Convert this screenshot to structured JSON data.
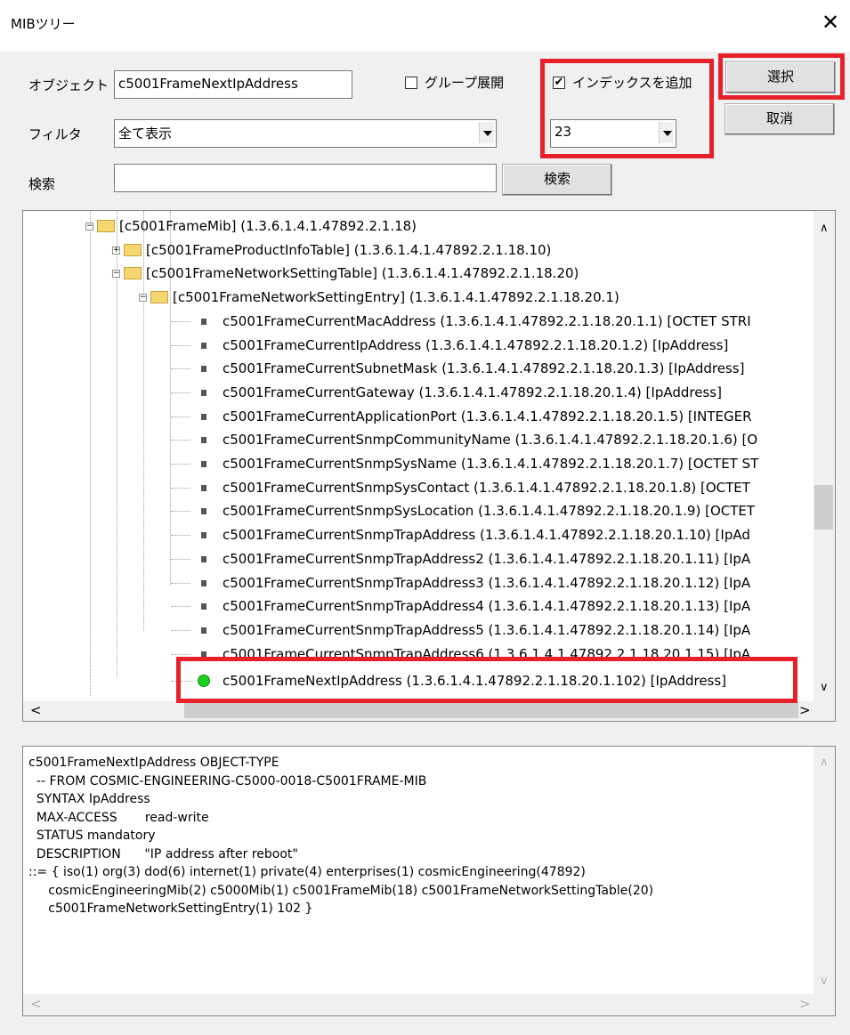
{
  "window": {
    "title": "MIBツリー",
    "close_label": "✕"
  },
  "form": {
    "object_label": "オブジェクト",
    "object_value": "c5001FrameNextIpAddress",
    "group_expand_label": "グループ展開",
    "group_expand_checked": false,
    "add_index_label": "インデックスを追加",
    "add_index_checked": true,
    "index_value": "23",
    "filter_label": "フィルタ",
    "filter_value": "全て表示",
    "search_label": "検索",
    "search_value": "",
    "search_button": "検索",
    "select_button": "選択",
    "cancel_button": "取消"
  },
  "tree": {
    "nodes": [
      {
        "type": "folder",
        "expander": "−",
        "text": "[c5001FrameMib] (1.3.6.1.4.1.47892.2.1.18)"
      },
      {
        "type": "folder",
        "expander": "+",
        "text": "[c5001FrameProductInfoTable] (1.3.6.1.4.1.47892.2.1.18.10)"
      },
      {
        "type": "folder",
        "expander": "−",
        "text": "[c5001FrameNetworkSettingTable] (1.3.6.1.4.1.47892.2.1.18.20)"
      },
      {
        "type": "folder",
        "expander": "−",
        "text": "[c5001FrameNetworkSettingEntry] (1.3.6.1.4.1.47892.2.1.18.20.1)"
      },
      {
        "type": "leaf",
        "text": "c5001FrameCurrentMacAddress (1.3.6.1.4.1.47892.2.1.18.20.1.1) [OCTET STRI"
      },
      {
        "type": "leaf",
        "text": "c5001FrameCurrentIpAddress (1.3.6.1.4.1.47892.2.1.18.20.1.2) [IpAddress]"
      },
      {
        "type": "leaf",
        "text": "c5001FrameCurrentSubnetMask (1.3.6.1.4.1.47892.2.1.18.20.1.3) [IpAddress]"
      },
      {
        "type": "leaf",
        "text": "c5001FrameCurrentGateway (1.3.6.1.4.1.47892.2.1.18.20.1.4) [IpAddress]"
      },
      {
        "type": "leaf",
        "text": "c5001FrameCurrentApplicationPort (1.3.6.1.4.1.47892.2.1.18.20.1.5) [INTEGER"
      },
      {
        "type": "leaf",
        "text": "c5001FrameCurrentSnmpCommunityName (1.3.6.1.4.1.47892.2.1.18.20.1.6) [O"
      },
      {
        "type": "leaf",
        "text": "c5001FrameCurrentSnmpSysName (1.3.6.1.4.1.47892.2.1.18.20.1.7) [OCTET ST"
      },
      {
        "type": "leaf",
        "text": "c5001FrameCurrentSnmpSysContact (1.3.6.1.4.1.47892.2.1.18.20.1.8) [OCTET"
      },
      {
        "type": "leaf",
        "text": "c5001FrameCurrentSnmpSysLocation (1.3.6.1.4.1.47892.2.1.18.20.1.9) [OCTET"
      },
      {
        "type": "leaf",
        "text": "c5001FrameCurrentSnmpTrapAddress (1.3.6.1.4.1.47892.2.1.18.20.1.10) [IpAd"
      },
      {
        "type": "leaf",
        "text": "c5001FrameCurrentSnmpTrapAddress2 (1.3.6.1.4.1.47892.2.1.18.20.1.11) [IpA"
      },
      {
        "type": "leaf",
        "text": "c5001FrameCurrentSnmpTrapAddress3 (1.3.6.1.4.1.47892.2.1.18.20.1.12) [IpA"
      },
      {
        "type": "leaf",
        "text": "c5001FrameCurrentSnmpTrapAddress4 (1.3.6.1.4.1.47892.2.1.18.20.1.13) [IpA"
      },
      {
        "type": "leaf",
        "text": "c5001FrameCurrentSnmpTrapAddress5 (1.3.6.1.4.1.47892.2.1.18.20.1.14) [IpA"
      },
      {
        "type": "leaf",
        "text": "c5001FrameCurrentSnmpTrapAddress6 (1.3.6.1.4.1.47892.2.1.18.20.1.15) [IpA"
      },
      {
        "type": "selected",
        "text": "c5001FrameNextIpAddress (1.3.6.1.4.1.47892.2.1.18.20.1.102) [IpAddress]"
      }
    ]
  },
  "description": {
    "lines": [
      "c5001FrameNextIpAddress OBJECT-TYPE",
      "  -- FROM COSMIC-ENGINEERING-C5000-0018-C5001FRAME-MIB",
      "  SYNTAX IpAddress",
      "  MAX-ACCESS       read-write",
      "  STATUS mandatory",
      "  DESCRIPTION      \"IP address after reboot\"",
      "::= { iso(1) org(3) dod(6) internet(1) private(4) enterprises(1) cosmicEngineering(47892)",
      "     cosmicEngineeringMib(2) c5000Mib(1) c5001FrameMib(18) c5001FrameNetworkSettingTable(20)",
      "     c5001FrameNetworkSettingEntry(1) 102 }"
    ]
  },
  "colors": {
    "highlight": "#e8202a",
    "status_dot": "#19d219"
  }
}
